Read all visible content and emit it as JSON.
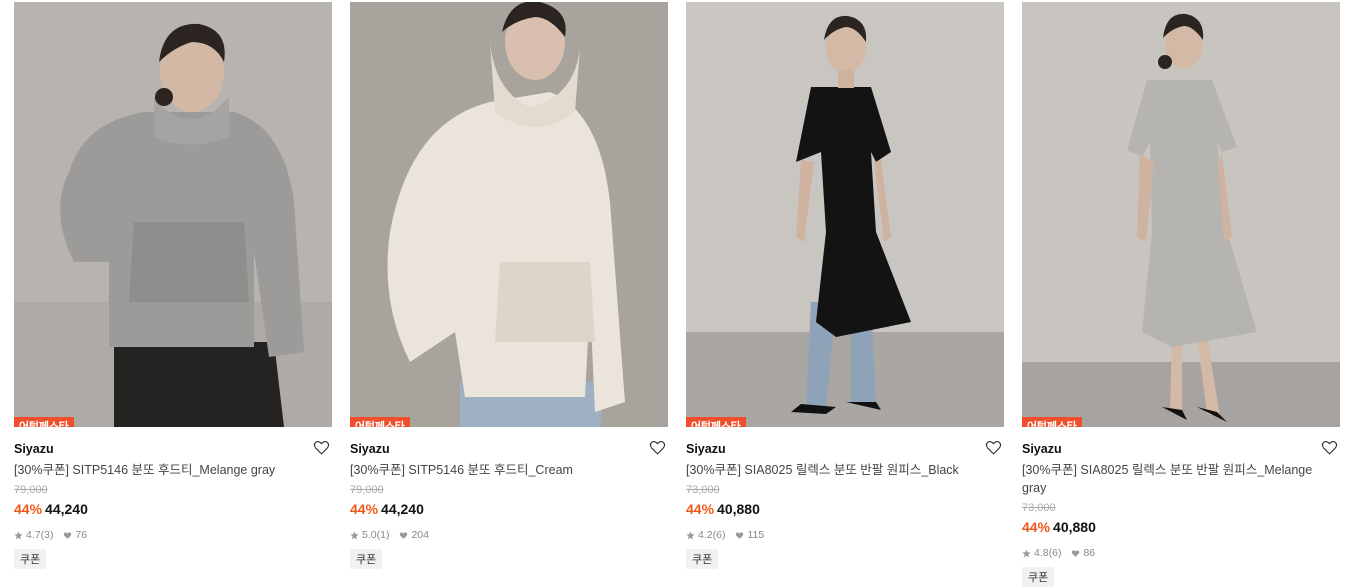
{
  "products": [
    {
      "badge": "어텀페스타",
      "brand": "Siyazu",
      "name": "[30%쿠폰] SITP5146 분또 후드티_Melange gray",
      "original_price": "79,000",
      "discount": "44%",
      "price": "44,240",
      "rating": "4.7",
      "reviews": "(3)",
      "likes": "76",
      "coupon": "쿠폰",
      "photo": "model-wearing-gray-hoodie"
    },
    {
      "badge": "어텀페스타",
      "brand": "Siyazu",
      "name": "[30%쿠폰] SITP5146 분또 후드티_Cream",
      "original_price": "79,000",
      "discount": "44%",
      "price": "44,240",
      "rating": "5.0",
      "reviews": "(1)",
      "likes": "204",
      "coupon": "쿠폰",
      "photo": "model-wearing-cream-hoodie"
    },
    {
      "badge": "어텀페스타",
      "brand": "Siyazu",
      "name": "[30%쿠폰] SIA8025 릴렉스 분또 반팔 원피스_Black",
      "original_price": "73,000",
      "discount": "44%",
      "price": "40,880",
      "rating": "4.2",
      "reviews": "(6)",
      "likes": "115",
      "coupon": "쿠폰",
      "photo": "model-wearing-black-dress"
    },
    {
      "badge": "어텀페스타",
      "brand": "Siyazu",
      "name": "[30%쿠폰] SIA8025 릴렉스 분또 반팔 원피스_Melange gray",
      "original_price": "73,000",
      "discount": "44%",
      "price": "40,880",
      "rating": "4.8",
      "reviews": "(6)",
      "likes": "86",
      "coupon": "쿠폰",
      "photo": "model-wearing-gray-dress"
    }
  ],
  "colors": {
    "badge": "#f04f2b",
    "discount": "#f0571c",
    "coupon_bg": "#f1f1f1"
  }
}
